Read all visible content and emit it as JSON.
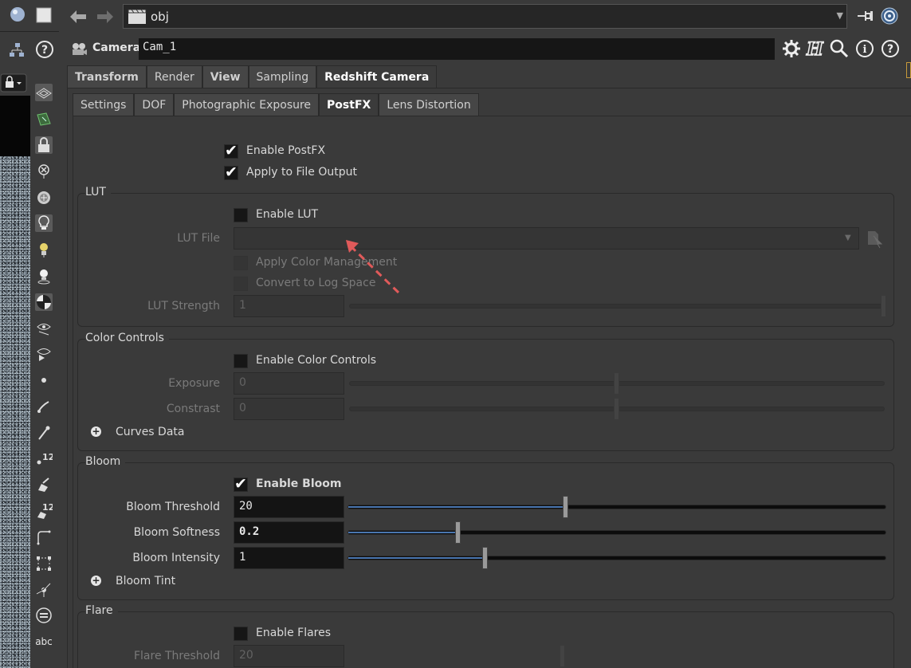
{
  "path": {
    "value": "obj"
  },
  "operator": {
    "type_label": "Camera",
    "name": "Cam_1"
  },
  "tabs_primary": [
    "Transform",
    "Render",
    "View",
    "Sampling",
    "Redshift Camera"
  ],
  "tabs_secondary": [
    "Settings",
    "DOF",
    "Photographic Exposure",
    "PostFX",
    "Lens Distortion"
  ],
  "postfx": {
    "enable_postfx": "Enable PostFX",
    "apply_to_file_output": "Apply to File Output"
  },
  "lut": {
    "title": "LUT",
    "enable": "Enable LUT",
    "file_label": "LUT File",
    "file_value": "",
    "apply_cm": "Apply Color Management",
    "log_space": "Convert to Log Space",
    "strength_label": "LUT Strength",
    "strength_value": "1"
  },
  "color_controls": {
    "title": "Color Controls",
    "enable": "Enable Color Controls",
    "exposure_label": "Exposure",
    "exposure_value": "0",
    "contrast_label": "Constrast",
    "contrast_value": "0",
    "curves_label": "Curves Data"
  },
  "bloom": {
    "title": "Bloom",
    "enable": "Enable Bloom",
    "threshold_label": "Bloom Threshold",
    "threshold_value": "20",
    "threshold_level": 0.4,
    "softness_label": "Bloom Softness",
    "softness_value": "0.2",
    "softness_level": 0.2,
    "intensity_label": "Bloom Intensity",
    "intensity_value": "1",
    "intensity_level": 0.25,
    "tint_label": "Bloom Tint"
  },
  "flare": {
    "title": "Flare",
    "enable": "Enable Flares",
    "threshold_label": "Flare Threshold",
    "threshold_value": "20"
  },
  "toolbar": {
    "text_tool_label": "abc",
    "badge_12": "12"
  },
  "colors": {
    "accent": "#4a76b0",
    "annotation_arrow": "#e05a5a"
  }
}
